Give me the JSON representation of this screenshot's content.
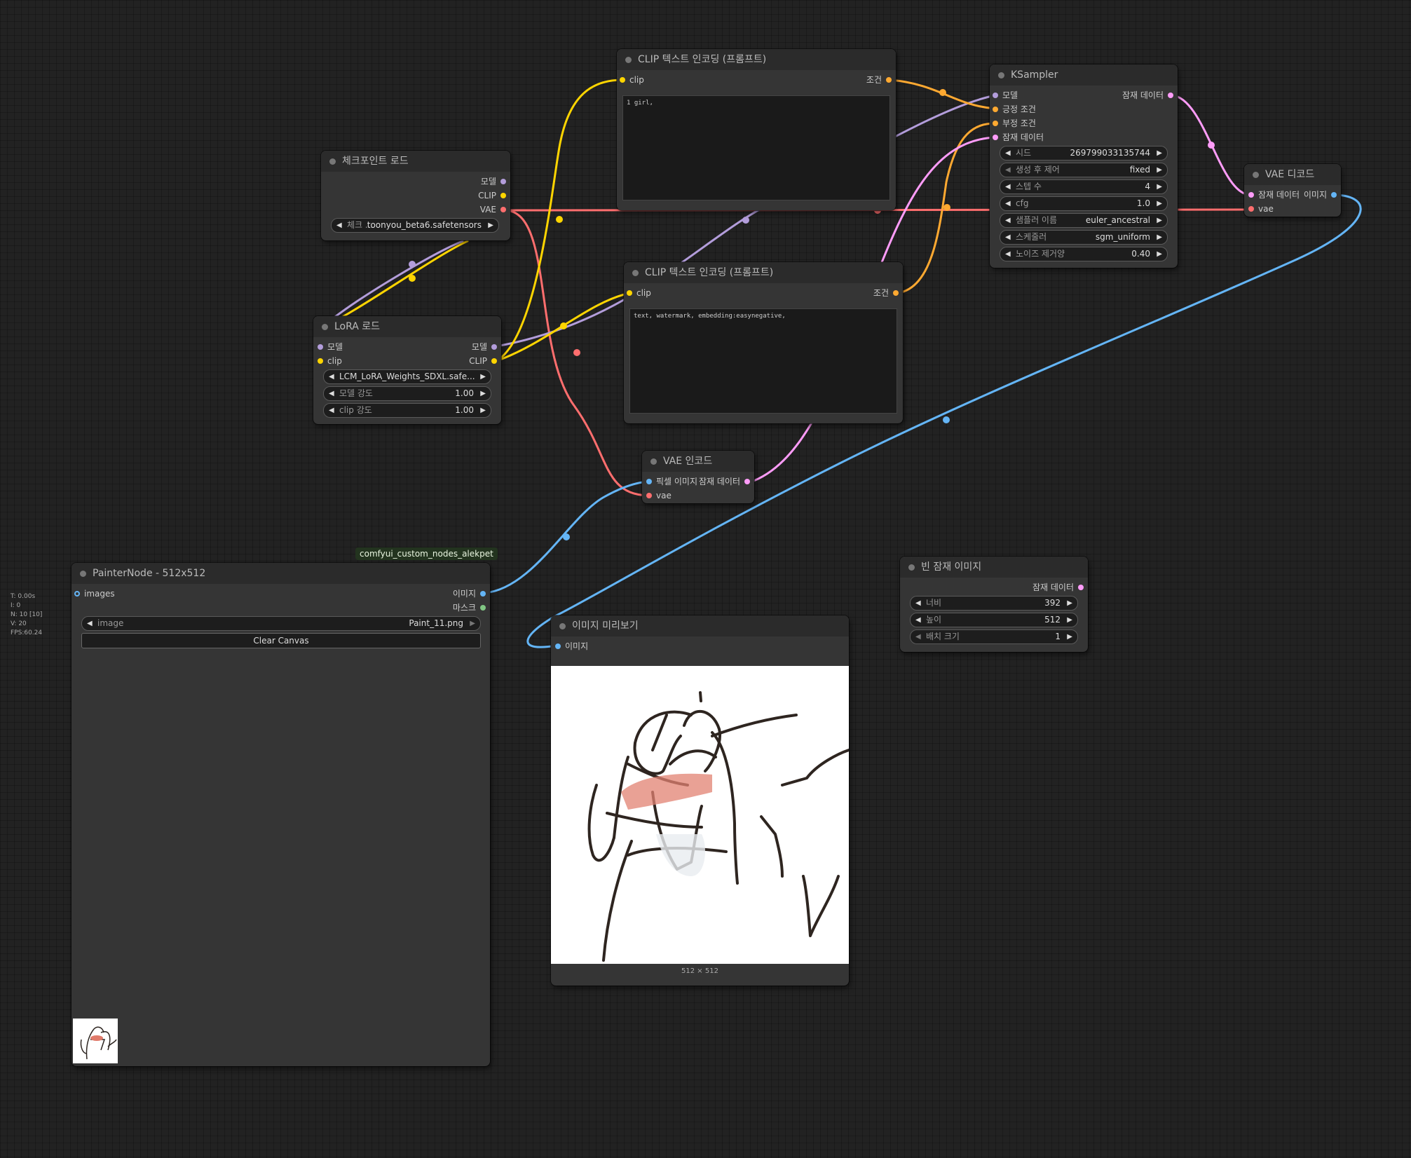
{
  "colors": {
    "model": "#b39ddb",
    "clip": "#ffd500",
    "vae": "#ff6e6e",
    "conditioning": "#ffa931",
    "latent": "#ff9cf9",
    "image": "#64b5f6",
    "mask": "#81c784"
  },
  "stats": {
    "t": "T: 0.00s",
    "i": "I: 0",
    "n": "N: 10 [10]",
    "v": "V: 20",
    "fps": "FPS:60.24"
  },
  "nodes": {
    "checkpoint": {
      "title": "체크포인트 로드",
      "out_model": "모델",
      "out_clip": "CLIP",
      "out_vae": "VAE",
      "ckpt_label": "체크 ...",
      "ckpt_value": "toonyou_beta6.safetensors"
    },
    "lora": {
      "title": "LoRA 로드",
      "in_model": "모델",
      "in_clip": "clip",
      "out_model": "모델",
      "out_clip": "CLIP",
      "lora_value": "LCM_LoRA_Weights_SDXL.safe...",
      "strength_model_label": "모델 강도",
      "strength_model_value": "1.00",
      "strength_clip_label": "clip 강도",
      "strength_clip_value": "1.00"
    },
    "clip_pos": {
      "title": "CLIP 텍스트 인코딩 (프롬프트)",
      "in_clip": "clip",
      "out_cond": "조건",
      "text": "1 girl,"
    },
    "clip_neg": {
      "title": "CLIP 텍스트 인코딩 (프롬프트)",
      "in_clip": "clip",
      "out_cond": "조건",
      "text": "text, watermark, embedding:easynegative,"
    },
    "ksampler": {
      "title": "KSampler",
      "in_model": "모델",
      "in_positive": "긍정 조건",
      "in_negative": "부정 조건",
      "in_latent": "잠재 데이터",
      "out_latent": "잠재 데이터",
      "seed_label": "시드",
      "seed_value": "269799033135744",
      "control_label": "생성 후 제어",
      "control_value": "fixed",
      "steps_label": "스텝 수",
      "steps_value": "4",
      "cfg_label": "cfg",
      "cfg_value": "1.0",
      "sampler_label": "샘플러 이름",
      "sampler_value": "euler_ancestral",
      "scheduler_label": "스케줄러",
      "scheduler_value": "sgm_uniform",
      "denoise_label": "노이즈 제거양",
      "denoise_value": "0.40"
    },
    "vae_decode": {
      "title": "VAE 디코드",
      "in_latent": "잠재 데이터",
      "in_vae": "vae",
      "out_image": "이미지"
    },
    "vae_encode": {
      "title": "VAE 인코드",
      "in_pixels": "픽셀 이미지",
      "in_vae": "vae",
      "out_latent": "잠재 데이터"
    },
    "painter": {
      "badge": "comfyui_custom_nodes_alekpet",
      "title": "PainterNode - 512x512",
      "in_images": "images",
      "out_image": "이미지",
      "out_mask": "마스크",
      "image_label": "image",
      "image_value": "Paint_11.png",
      "clear_label": "Clear Canvas"
    },
    "preview": {
      "title": "이미지 미리보기",
      "in_images": "이미지",
      "size_caption": "512 × 512"
    },
    "empty_latent": {
      "title": "빈 잠재 이미지",
      "out_latent": "잠재 데이터",
      "width_label": "너비",
      "width_value": "392",
      "height_label": "높이",
      "height_value": "512",
      "batch_label": "배치 크기",
      "batch_value": "1"
    }
  }
}
